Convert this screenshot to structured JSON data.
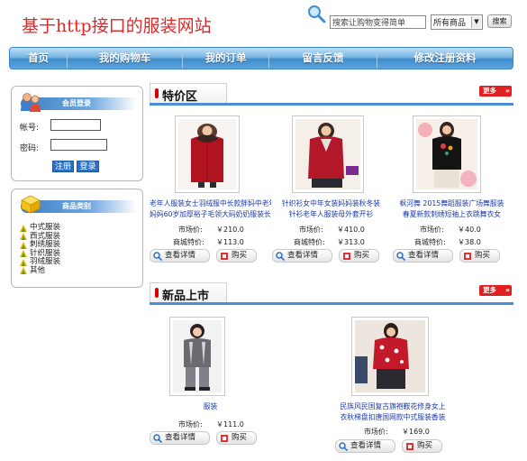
{
  "header": {
    "logo_text": "基于http接口的服装网站",
    "search_placeholder": "搜索让购物变得简单",
    "category_select": "所有商品",
    "search_button": "搜索"
  },
  "nav": {
    "items": [
      {
        "label": "首页"
      },
      {
        "label": "我的购物车"
      },
      {
        "label": "我的订单"
      },
      {
        "label": "留言反馈"
      },
      {
        "label": "修改注册资料"
      }
    ]
  },
  "login": {
    "title": "会员登录",
    "account_label": "帐号:",
    "password_label": "密码:",
    "register_button": "注册",
    "login_button": "登录"
  },
  "categories": {
    "title": "商品类别",
    "items": [
      "中式服装",
      "西式服装",
      "刺绣服装",
      "针织服装",
      "羽绒服装",
      "其他"
    ]
  },
  "special": {
    "title": "特价区",
    "more": "更多",
    "products": [
      {
        "name_line1": "老年人服装女士羽绒服中长款胖妈中老年",
        "name_line2": "妈妈60岁加厚裕子毛领大码奶奶服装长袖",
        "market_label": "市场价:",
        "market_price": "￥210.0",
        "mall_label": "商城特价:",
        "mall_price": "￥113.0",
        "detail_btn": "查看详情",
        "buy_btn": "购买"
      },
      {
        "name_line1": "针织衫女中年女装妈妈装秋冬装",
        "name_line2": "针衫老年人服装母外套开衫",
        "market_label": "市场价:",
        "market_price": "￥410.0",
        "mall_label": "商城特价:",
        "mall_price": "￥313.0",
        "detail_btn": "查看详情",
        "buy_btn": "购买"
      },
      {
        "name_line1": "枫河舞 2015舞蹈服装广场舞服装",
        "name_line2": "春夏新款刺绣短袖上衣跳舞衣女",
        "market_label": "市场价:",
        "market_price": "￥40.0",
        "mall_label": "商城特价:",
        "mall_price": "￥38.0",
        "detail_btn": "查看详情",
        "buy_btn": "购买"
      }
    ]
  },
  "new_arrivals": {
    "title": "新品上市",
    "more": "更多",
    "products": [
      {
        "name_line1": "服装",
        "name_line2": "",
        "market_label": "市场价:",
        "market_price": "￥111.0",
        "detail_btn": "查看详情",
        "buy_btn": "购买"
      },
      {
        "name_line1": "民族风民国复古旗袍鞍花修身女上",
        "name_line2": "衣秋梯盘扣唐国网款中式服装香装",
        "market_label": "市场价:",
        "market_price": "￥169.0",
        "detail_btn": "查看详情",
        "buy_btn": "购买"
      }
    ]
  },
  "colors": {
    "logo": "#e0282a",
    "nav": "#4a95d6",
    "link": "#1a3aa8",
    "more": "#e02020"
  }
}
